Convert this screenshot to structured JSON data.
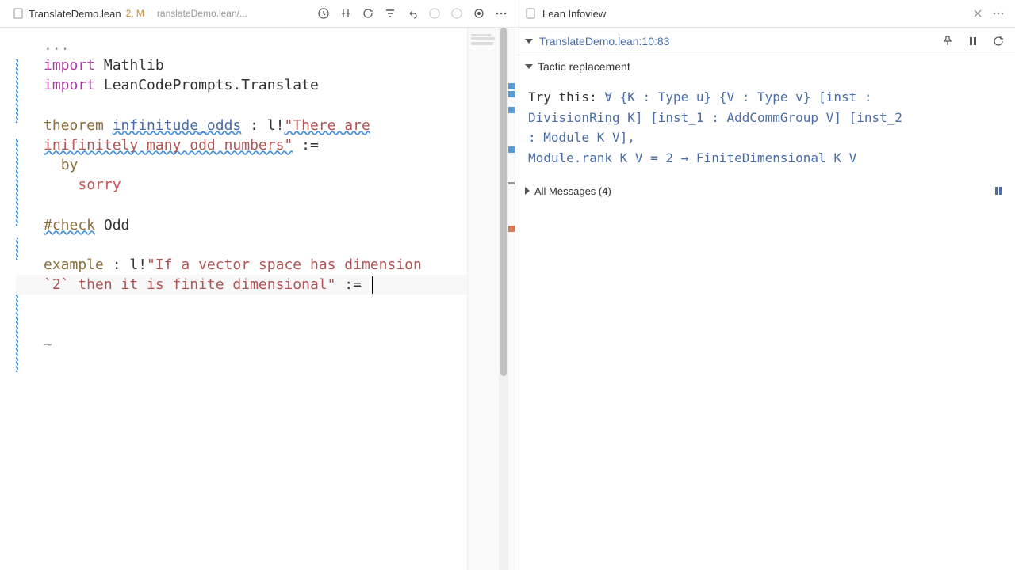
{
  "leftPane": {
    "tab": {
      "filename": "TranslateDemo.lean",
      "badge": "2, M",
      "breadcrumb": "ranslateDemo.lean/..."
    },
    "code": {
      "dots": "...",
      "line1_kw": "import",
      "line1_rest": " Mathlib",
      "line2_kw": "import",
      "line2_rest": " LeanCodePrompts.Translate",
      "line4_kw": "theorem",
      "line4_ident": "infinitude_odds",
      "line4_rest": " : l!",
      "line4_str": "\"There are",
      "line5_str": "inifinitely many odd numbers\"",
      "line5_rest": " :=",
      "line6_by": "by",
      "line7_sorry": "sorry",
      "line9_check": "#check",
      "line9_ident": " Odd",
      "line11_kw": "example",
      "line11_rest": " : l!",
      "line11_str": "\"If a vector space has dimension",
      "line12_str": "`2` then it is finite dimensional\"",
      "line12_rest": " := ",
      "tilde": "~"
    }
  },
  "rightPane": {
    "tab": "Lean Infoview",
    "header": "TranslateDemo.lean:10:83",
    "section": "Tactic replacement",
    "tryThis": "Try this: ",
    "hint_l1": "∀ {K : Type u} {V : Type v} [inst :",
    "hint_l2": "DivisionRing K] [inst_1 : AddCommGroup V] [inst_2",
    "hint_l3": ": Module K V],",
    "hint_l4": "  Module.rank K V = 2 → FiniteDimensional K V",
    "messages": "All Messages (4)"
  }
}
